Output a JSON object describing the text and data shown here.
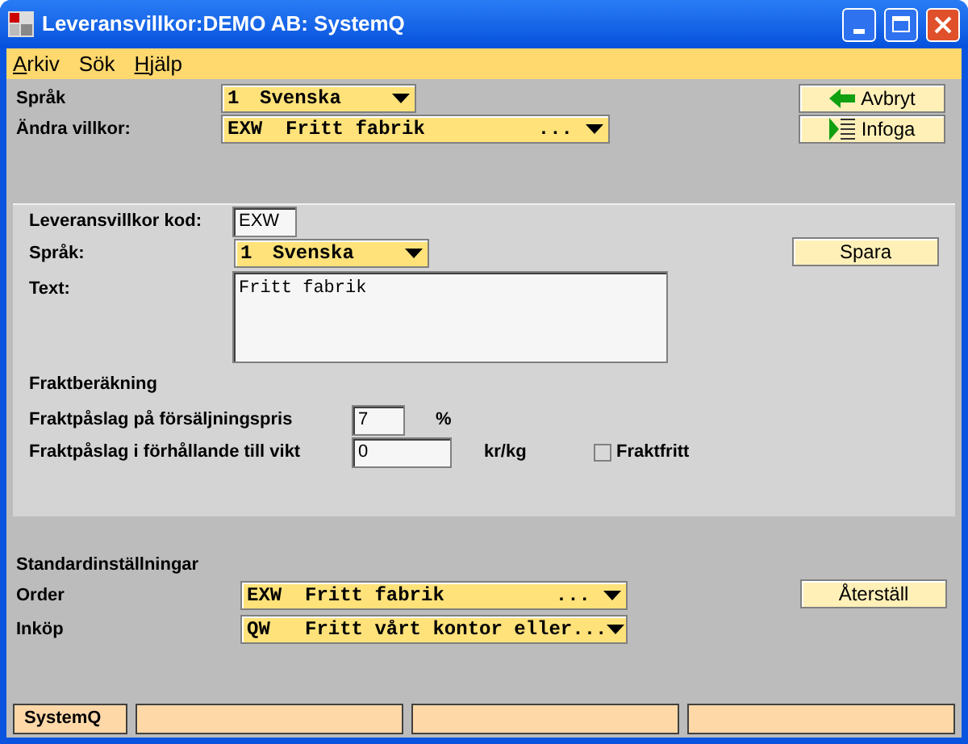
{
  "window": {
    "title": "Leveransvillkor:DEMO AB: SystemQ"
  },
  "menu": [
    {
      "label": "Arkiv",
      "underlined": true
    },
    {
      "label": "Sök",
      "underlined": false
    },
    {
      "label": "Hjälp",
      "underlined": true
    }
  ],
  "header": {
    "language_label": "Språk",
    "language": {
      "code": "1",
      "text": "Svenska"
    },
    "terms_label": "Ändra villkor:",
    "terms": {
      "code": "EXW",
      "text": "Fritt fabrik",
      "suffix": "..."
    },
    "buttons": [
      {
        "label": "Avbryt",
        "kind": "back"
      },
      {
        "label": "Infoga",
        "kind": "insert"
      }
    ]
  },
  "form": {
    "code_label": "Leveransvillkor kod:",
    "code": "EXW",
    "language_label": "Språk:",
    "language": {
      "code": "1",
      "text": "Svenska"
    },
    "save_button": "Spara",
    "text_label": "Text:",
    "text": "Fritt fabrik",
    "freight_heading": "Fraktberäkning",
    "markup_label": "Fraktpåslag på försäljningspris",
    "markup": "7",
    "markup_unit": "%",
    "weight_label": "Fraktpåslag i förhållande till vikt",
    "weight": "0",
    "weight_unit": "kr/kg",
    "free_freight": {
      "label": "Fraktfritt",
      "checked": false
    }
  },
  "defaults": {
    "heading": "Standardinställningar",
    "rows": [
      {
        "label": "Order",
        "code": "EXW",
        "text": "Fritt fabrik",
        "suffix": "..."
      },
      {
        "label": "Inköp",
        "code": "QW",
        "text": "Fritt vårt kontor eller..."
      }
    ],
    "reset_button": "Återställ"
  },
  "status_bar": [
    "SystemQ"
  ]
}
